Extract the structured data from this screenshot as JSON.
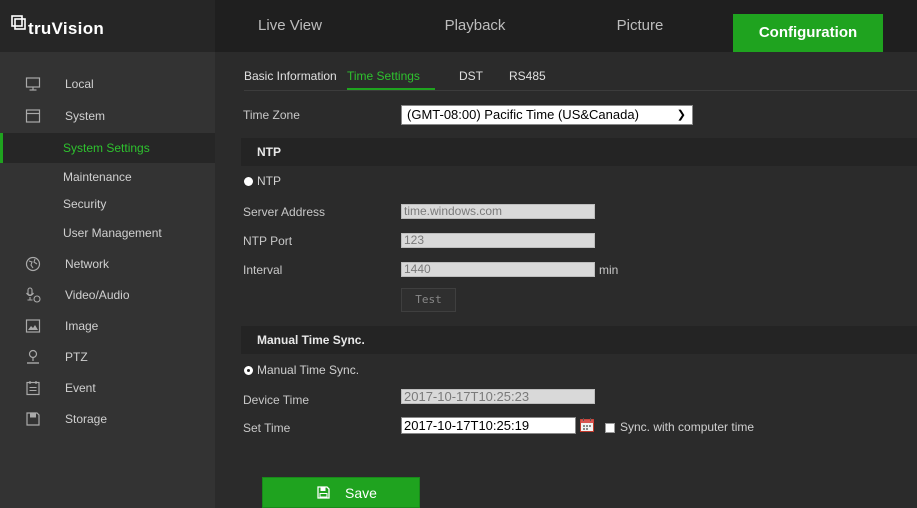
{
  "app": {
    "logo_text": "truVision"
  },
  "nav": {
    "tabs": [
      {
        "label": "Live View"
      },
      {
        "label": "Playback"
      },
      {
        "label": "Picture"
      },
      {
        "label": "Configuration",
        "active": true
      }
    ]
  },
  "sidebar": {
    "items": [
      {
        "label": "Local",
        "icon": "monitor-icon"
      },
      {
        "label": "System",
        "icon": "system-icon"
      },
      {
        "label": "System Settings",
        "active": true
      },
      {
        "label": "Maintenance"
      },
      {
        "label": "Security"
      },
      {
        "label": "User Management"
      },
      {
        "label": "Network",
        "icon": "globe-icon"
      },
      {
        "label": "Video/Audio",
        "icon": "microphone-icon"
      },
      {
        "label": "Image",
        "icon": "image-icon"
      },
      {
        "label": "PTZ",
        "icon": "ptz-icon"
      },
      {
        "label": "Event",
        "icon": "calendar-icon"
      },
      {
        "label": "Storage",
        "icon": "storage-icon"
      }
    ]
  },
  "subtabs": [
    {
      "label": "Basic Information"
    },
    {
      "label": "Time Settings",
      "active": true
    },
    {
      "label": "DST"
    },
    {
      "label": "RS485"
    }
  ],
  "form": {
    "time_zone_label": "Time Zone",
    "time_zone_value": "(GMT-08:00) Pacific Time (US&Canada)",
    "ntp_section": "NTP",
    "ntp_radio_label": "NTP",
    "server_address_label": "Server Address",
    "server_address_value": "time.windows.com",
    "ntp_port_label": "NTP Port",
    "ntp_port_value": "123",
    "interval_label": "Interval",
    "interval_value": "1440",
    "interval_unit": "min",
    "test_label": "Test",
    "manual_section": "Manual Time Sync.",
    "manual_radio_label": "Manual Time Sync.",
    "device_time_label": "Device Time",
    "device_time_value": "2017-10-17T10:25:23",
    "set_time_label": "Set Time",
    "set_time_value": "2017-10-17T10:25:19",
    "sync_computer_label": "Sync. with computer time",
    "save_label": "Save"
  },
  "colors": {
    "accent": "#1fa31f",
    "active_text": "#2ec22e",
    "sidebar_bg": "#333333",
    "content_bg": "#2b2b2b"
  }
}
